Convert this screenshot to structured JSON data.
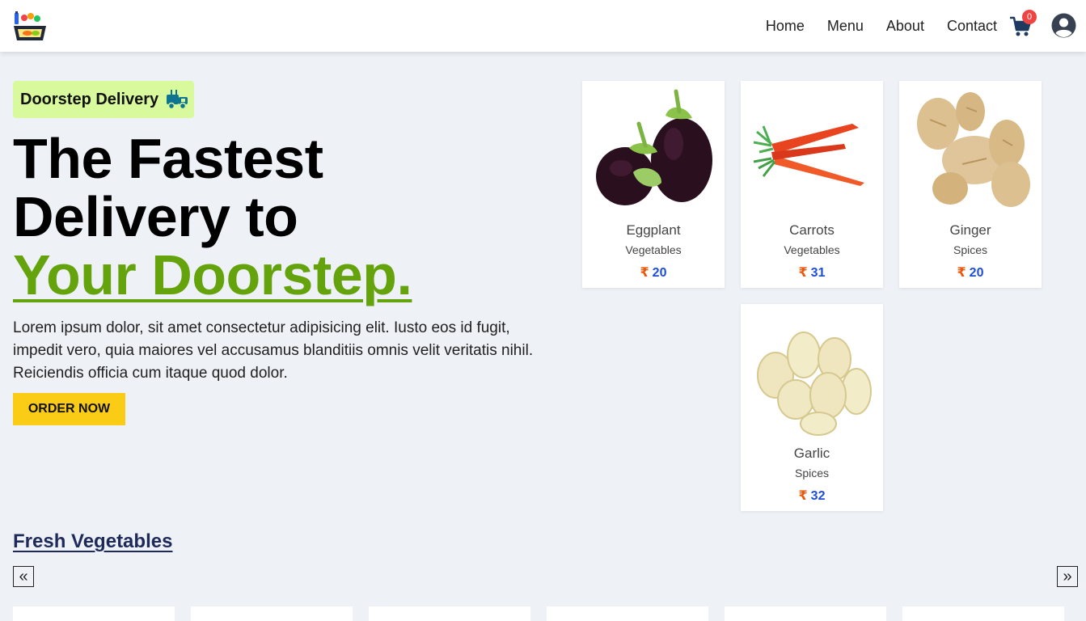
{
  "header": {
    "nav": [
      "Home",
      "Menu",
      "About",
      "Contact"
    ],
    "cart_count": "0"
  },
  "hero": {
    "badge": "Doorstep Delivery",
    "title_line1": "The Fastest",
    "title_line2": "Delivery to",
    "title_line3": "Your Doorstep.",
    "text": "Lorem ipsum dolor, sit amet consectetur adipisicing elit. Iusto eos id fugit, impedit vero, quia maiores vel accusamus blanditiis omnis velit veritatis nihil. Reiciendis officia cum itaque quod dolor.",
    "button": "ORDER NOW"
  },
  "products": [
    {
      "name": "Eggplant",
      "category": "Vegetables",
      "currency": "₹",
      "price": "20"
    },
    {
      "name": "Carrots",
      "category": "Vegetables",
      "currency": "₹",
      "price": "31"
    },
    {
      "name": "Ginger",
      "category": "Spices",
      "currency": "₹",
      "price": "20"
    },
    {
      "name": "Garlic",
      "category": "Spices",
      "currency": "₹",
      "price": "32"
    }
  ],
  "section": {
    "title": "Fresh Vegetables",
    "prev": "«",
    "next": "»"
  },
  "colors": {
    "accent_green": "#65a30d",
    "badge_bg": "#d9f99d",
    "button_yellow": "#facc15",
    "price_blue": "#1d4ed8",
    "rupee_orange": "#ea580c"
  }
}
